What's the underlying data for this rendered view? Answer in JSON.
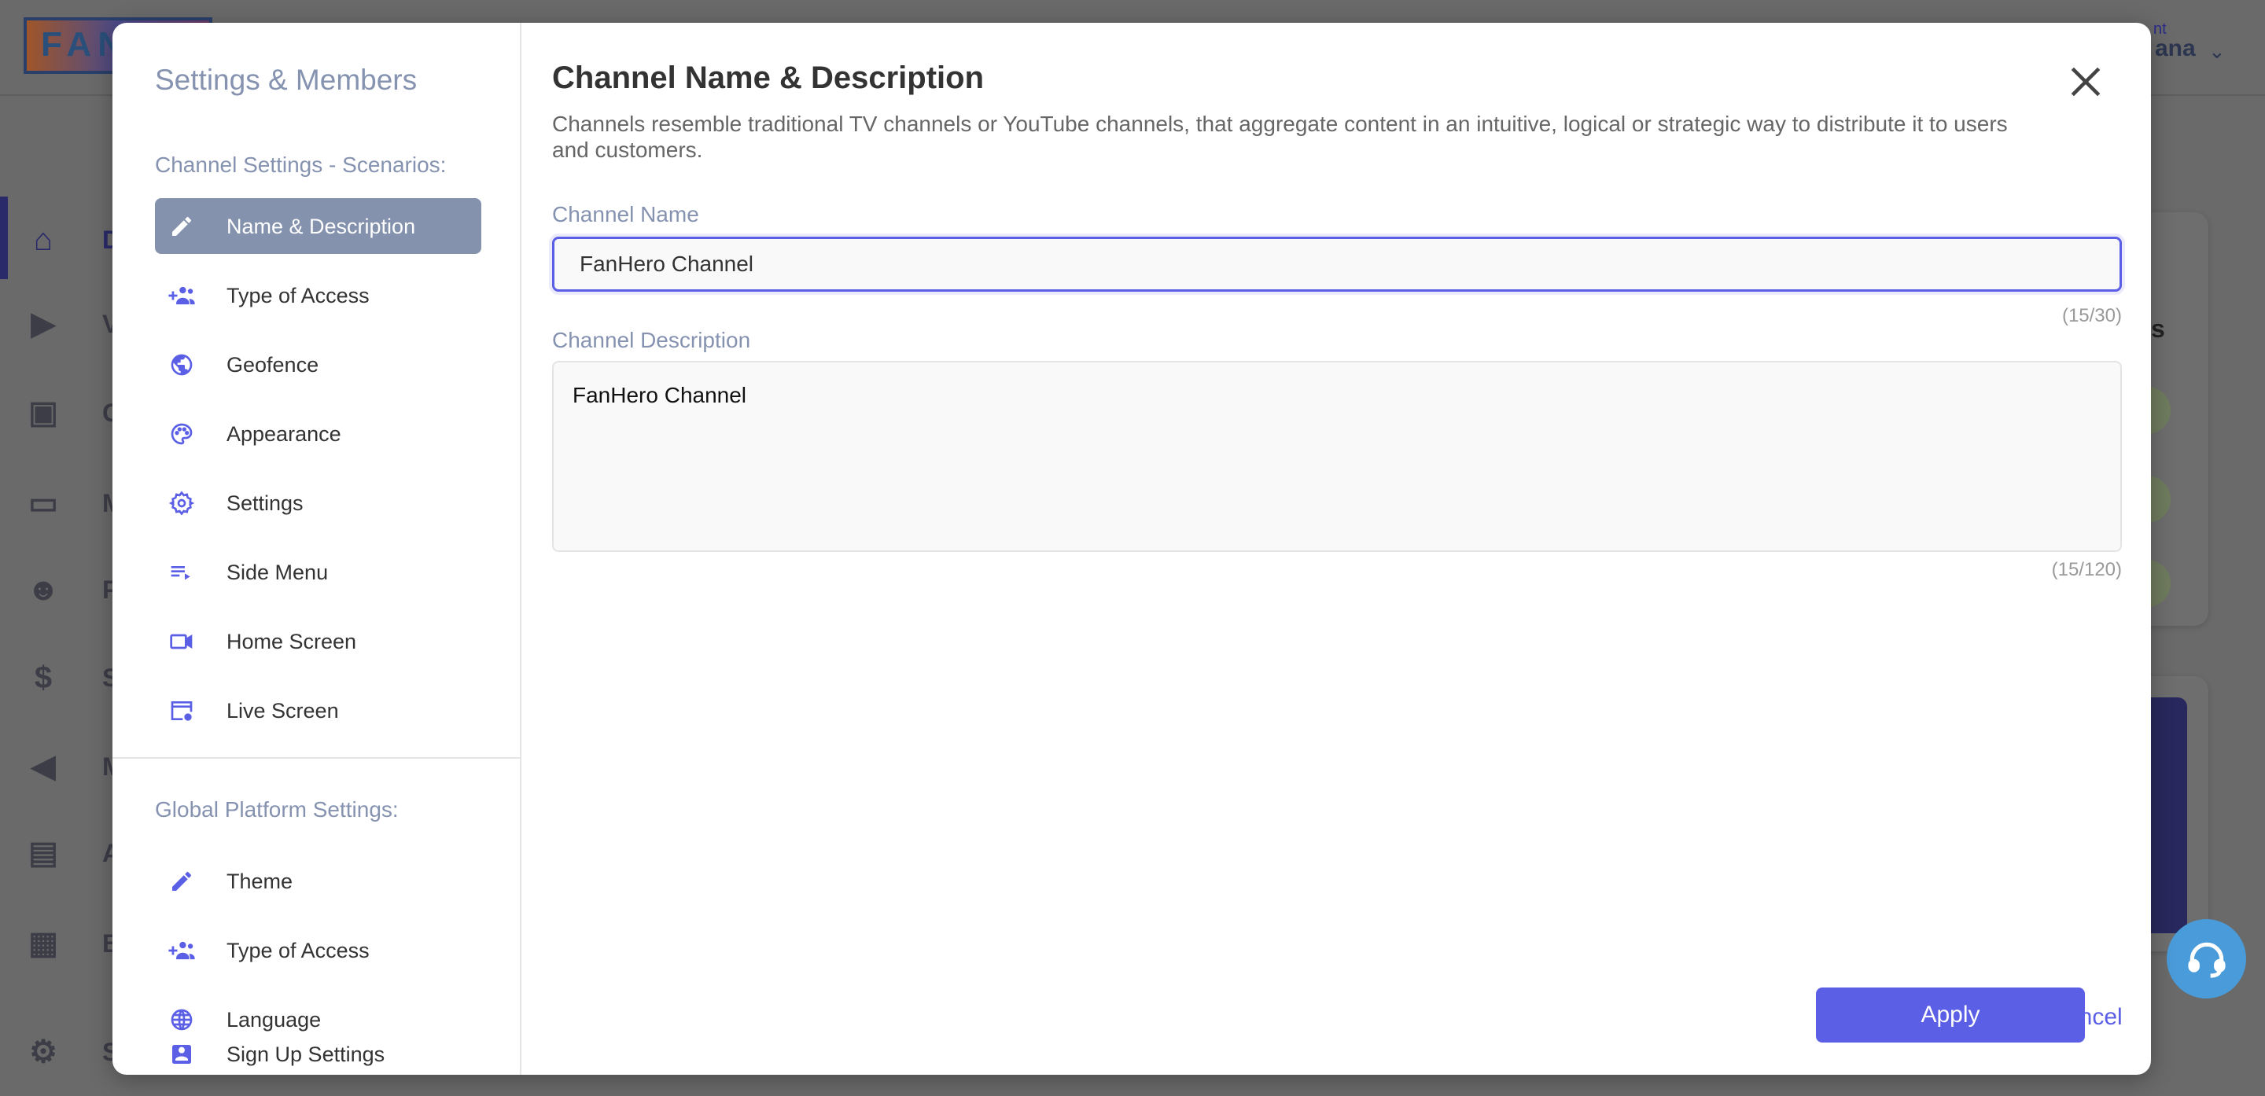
{
  "background": {
    "logo": "FAN",
    "sidebar_fragments": [
      "D",
      "Vi",
      "Go",
      "Ma",
      "Pe",
      "Sa",
      "Ma",
      "An",
      "Bil",
      "Se"
    ],
    "user_fragment_top": "nt",
    "user_fragment": "ana",
    "card_fragment": "s"
  },
  "left_panel": {
    "title": "Settings & Members",
    "channel_section": "Channel Settings - Scenarios:",
    "channel_items": [
      {
        "label": "Name & Description",
        "icon": "pencil-icon",
        "active": true
      },
      {
        "label": "Type of Access",
        "icon": "group-add-icon"
      },
      {
        "label": "Geofence",
        "icon": "globe-icon"
      },
      {
        "label": "Appearance",
        "icon": "palette-icon"
      },
      {
        "label": "Settings",
        "icon": "gear-icon"
      },
      {
        "label": "Side Menu",
        "icon": "playlist-icon"
      },
      {
        "label": "Home Screen",
        "icon": "video-camera-icon"
      },
      {
        "label": "Live Screen",
        "icon": "screen-settings-icon"
      }
    ],
    "global_section": "Global Platform Settings:",
    "global_items": [
      {
        "label": "Theme",
        "icon": "pencil-icon"
      },
      {
        "label": "Type of Access",
        "icon": "group-add-icon"
      },
      {
        "label": "Language",
        "icon": "language-globe-icon"
      },
      {
        "label": "Sign Up Settings",
        "icon": "account-box-icon"
      }
    ]
  },
  "main": {
    "title": "Channel Name & Description",
    "description": "Channels resemble traditional TV channels or YouTube channels, that aggregate content in an intuitive, logical or strategic way to distribute it to users and customers.",
    "name_label": "Channel Name",
    "name_value": "FanHero Channel",
    "name_count": "(15/30)",
    "desc_label": "Channel Description",
    "desc_value": "FanHero Channel",
    "desc_count": "(15/120)",
    "cancel": "Cancel",
    "apply": "Apply"
  },
  "colors": {
    "accent": "#5b5fe6",
    "active_item": "#8592ad",
    "section": "#8592b0"
  }
}
